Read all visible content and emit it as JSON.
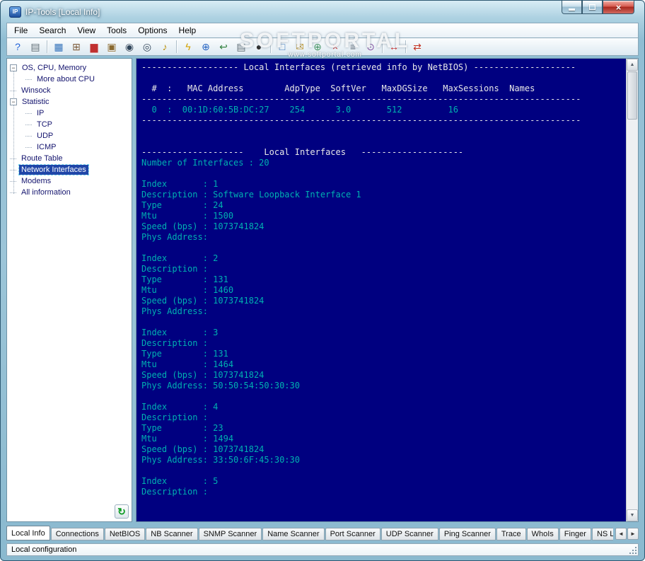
{
  "window": {
    "title": "IP-Tools [Local Info]",
    "icon_label": "IP",
    "close_glyph": "×"
  },
  "ui": {
    "up_glyph": "▲",
    "down_glyph": "▼",
    "tab_left_glyph": "◄",
    "tab_right_glyph": "►",
    "refresh_glyph": "↻",
    "collapse_glyph": "−"
  },
  "colors": {
    "console_bg": "#000080",
    "console_text": "#00b0b0",
    "console_heading": "#e8e8e8",
    "selection": "#2046a8",
    "titlebar_accent": "#8fbdd3"
  },
  "watermark": {
    "title": "SOFTPORTAL",
    "subtitle": "www.softportal.com"
  },
  "menu": {
    "items": [
      "File",
      "Search",
      "View",
      "Tools",
      "Options",
      "Help"
    ]
  },
  "toolbar": {
    "icons": [
      {
        "name": "about-icon",
        "glyph": "?",
        "color": "#1c5fd6"
      },
      {
        "name": "print-icon",
        "glyph": "▤",
        "color": "#5a6a74"
      },
      {
        "separator": true
      },
      {
        "name": "local-info-icon",
        "glyph": "▦",
        "color": "#2f6fb8"
      },
      {
        "name": "connections-icon",
        "glyph": "⊞",
        "color": "#7a5a3a"
      },
      {
        "name": "statistics-icon",
        "glyph": "▆",
        "color": "#c03030"
      },
      {
        "name": "library-icon",
        "glyph": "▣",
        "color": "#8a6a30"
      },
      {
        "name": "find-icon",
        "glyph": "◉",
        "color": "#30455a"
      },
      {
        "name": "find-next-icon",
        "glyph": "◎",
        "color": "#30455a"
      },
      {
        "name": "sound-icon",
        "glyph": "♪",
        "color": "#b89010"
      },
      {
        "separator": true
      },
      {
        "name": "trace-icon",
        "glyph": "ϟ",
        "color": "#d0a000"
      },
      {
        "name": "web-browser-icon",
        "glyph": "⊕",
        "color": "#2060c0"
      },
      {
        "name": "back-icon",
        "glyph": "↩",
        "color": "#308040"
      },
      {
        "name": "print-report-icon",
        "glyph": "▤",
        "color": "#5a6a74"
      },
      {
        "name": "port-scanner-icon",
        "glyph": "●",
        "color": "#303030"
      },
      {
        "separator": true
      },
      {
        "name": "netbios-icon",
        "glyph": "□",
        "color": "#2f6fb8"
      },
      {
        "name": "finger-icon",
        "glyph": "✉",
        "color": "#b8902a"
      },
      {
        "name": "whois-icon",
        "glyph": "⊕",
        "color": "#409060"
      },
      {
        "name": "close-session-icon",
        "glyph": "×",
        "color": "#c02020"
      },
      {
        "name": "notes-icon",
        "glyph": "≡",
        "color": "#506070"
      },
      {
        "name": "time-icon",
        "glyph": "⊙",
        "color": "#8050a0"
      },
      {
        "separator": true
      },
      {
        "name": "ping-scanner-icon",
        "glyph": "↔",
        "color": "#c02020"
      },
      {
        "separator": true
      },
      {
        "name": "exchange-icon",
        "glyph": "⇄",
        "color": "#c03020"
      }
    ]
  },
  "tree": {
    "items": [
      {
        "label": "OS, CPU, Memory",
        "level": 0,
        "expandable": true
      },
      {
        "label": "More about CPU",
        "level": 1
      },
      {
        "label": "Winsock",
        "level": 0
      },
      {
        "label": "Statistic",
        "level": 0,
        "expandable": true
      },
      {
        "label": "IP",
        "level": 1
      },
      {
        "label": "TCP",
        "level": 1
      },
      {
        "label": "UDP",
        "level": 1
      },
      {
        "label": "ICMP",
        "level": 1
      },
      {
        "label": "Route Table",
        "level": 0
      },
      {
        "label": "Network Interfaces",
        "level": 0,
        "selected": true
      },
      {
        "label": "Modems",
        "level": 0
      },
      {
        "label": "All information",
        "level": 0
      }
    ]
  },
  "console": {
    "lines": [
      {
        "c": "h",
        "t": "------------------- Local Interfaces (retrieved info by NetBIOS) --------------------"
      },
      {
        "c": "t",
        "t": ""
      },
      {
        "c": "h",
        "t": "  #  :   MAC Address        AdpType  SoftVer   MaxDGSize   MaxSessions  Names"
      },
      {
        "c": "h",
        "t": "--------------------------------------------------------------------------------------"
      },
      {
        "c": "t",
        "t": "  0  :  00:1D:60:5B:DC:27    254      3.0       512         16"
      },
      {
        "c": "h",
        "t": "--------------------------------------------------------------------------------------"
      },
      {
        "c": "t",
        "t": ""
      },
      {
        "c": "t",
        "t": ""
      },
      {
        "c": "h",
        "t": "--------------------    Local Interfaces   --------------------"
      },
      {
        "c": "t",
        "t": "Number of Interfaces : 20"
      },
      {
        "c": "t",
        "t": ""
      },
      {
        "c": "t",
        "t": "Index       : 1"
      },
      {
        "c": "t",
        "t": "Description : Software Loopback Interface 1"
      },
      {
        "c": "t",
        "t": "Type        : 24"
      },
      {
        "c": "t",
        "t": "Mtu         : 1500"
      },
      {
        "c": "t",
        "t": "Speed (bps) : 1073741824"
      },
      {
        "c": "t",
        "t": "Phys Address:"
      },
      {
        "c": "t",
        "t": ""
      },
      {
        "c": "t",
        "t": "Index       : 2"
      },
      {
        "c": "t",
        "t": "Description :"
      },
      {
        "c": "t",
        "t": "Type        : 131"
      },
      {
        "c": "t",
        "t": "Mtu         : 1460"
      },
      {
        "c": "t",
        "t": "Speed (bps) : 1073741824"
      },
      {
        "c": "t",
        "t": "Phys Address:"
      },
      {
        "c": "t",
        "t": ""
      },
      {
        "c": "t",
        "t": "Index       : 3"
      },
      {
        "c": "t",
        "t": "Description :"
      },
      {
        "c": "t",
        "t": "Type        : 131"
      },
      {
        "c": "t",
        "t": "Mtu         : 1464"
      },
      {
        "c": "t",
        "t": "Speed (bps) : 1073741824"
      },
      {
        "c": "t",
        "t": "Phys Address: 50:50:54:50:30:30"
      },
      {
        "c": "t",
        "t": ""
      },
      {
        "c": "t",
        "t": "Index       : 4"
      },
      {
        "c": "t",
        "t": "Description :"
      },
      {
        "c": "t",
        "t": "Type        : 23"
      },
      {
        "c": "t",
        "t": "Mtu         : 1494"
      },
      {
        "c": "t",
        "t": "Speed (bps) : 1073741824"
      },
      {
        "c": "t",
        "t": "Phys Address: 33:50:6F:45:30:30"
      },
      {
        "c": "t",
        "t": ""
      },
      {
        "c": "t",
        "t": "Index       : 5"
      },
      {
        "c": "t",
        "t": "Description :"
      }
    ]
  },
  "tabs": {
    "active_index": 0,
    "items": [
      "Local Info",
      "Connections",
      "NetBIOS",
      "NB Scanner",
      "SNMP Scanner",
      "Name Scanner",
      "Port Scanner",
      "UDP Scanner",
      "Ping Scanner",
      "Trace",
      "WhoIs",
      "Finger",
      "NS Lookup"
    ]
  },
  "status": {
    "text": "Local configuration"
  }
}
